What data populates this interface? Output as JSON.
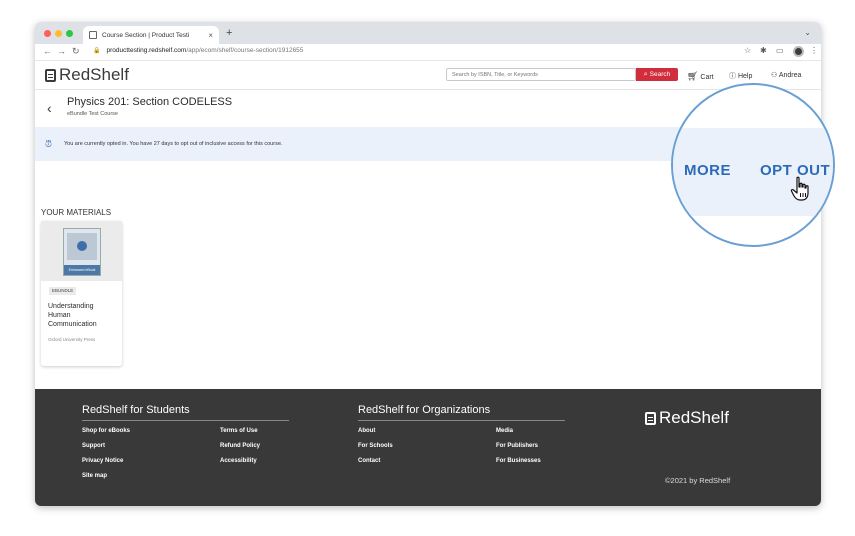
{
  "browser": {
    "tab_title": "Course Section | Product Testi",
    "tab_close": "×",
    "new_tab": "+",
    "url_domain": "producttesting.redshelf.com",
    "url_path": "/app/ecom/shelf/course-section/1912655"
  },
  "header": {
    "logo_text": "RedShelf",
    "search_placeholder": "Search by ISBN, Title, or Keywords",
    "search_button": "Search",
    "cart_label": "Cart",
    "help_label": "Help",
    "user_label": "Andrea"
  },
  "course": {
    "title": "Physics 201: Section CODELESS",
    "subtitle": "eBundle Test Course"
  },
  "notice": {
    "text": "You are currently opted in. You have 27 days to opt out of inclusive access for this course."
  },
  "materials": {
    "heading": "YOUR MATERIALS",
    "items": [
      {
        "badge": "EBUNDLE",
        "title": "Understanding Human Communication",
        "publisher": "Oxford University Press",
        "cover_band": "Enhanced eBook"
      }
    ]
  },
  "footer": {
    "students_heading": "RedShelf for Students",
    "organizations_heading": "RedShelf for Organizations",
    "students_links_col1": [
      "Shop for eBooks",
      "Support",
      "Privacy Notice",
      "Site map"
    ],
    "students_links_col2": [
      "Terms of Use",
      "Refund Policy",
      "Accessibility"
    ],
    "org_links_col1": [
      "About",
      "For Schools",
      "Contact"
    ],
    "org_links_col2": [
      "Media",
      "For Publishers",
      "For Businesses"
    ],
    "logo_text": "RedShelf",
    "copyright": "©2021 by RedShelf"
  },
  "zoom": {
    "more_label": "MORE",
    "optout_label": "OPT OUT"
  },
  "colors": {
    "accent_blue": "#2c6bb8",
    "search_red": "#d22d3c",
    "notice_bg": "#eaf1fb",
    "footer_bg": "#3a3939"
  }
}
